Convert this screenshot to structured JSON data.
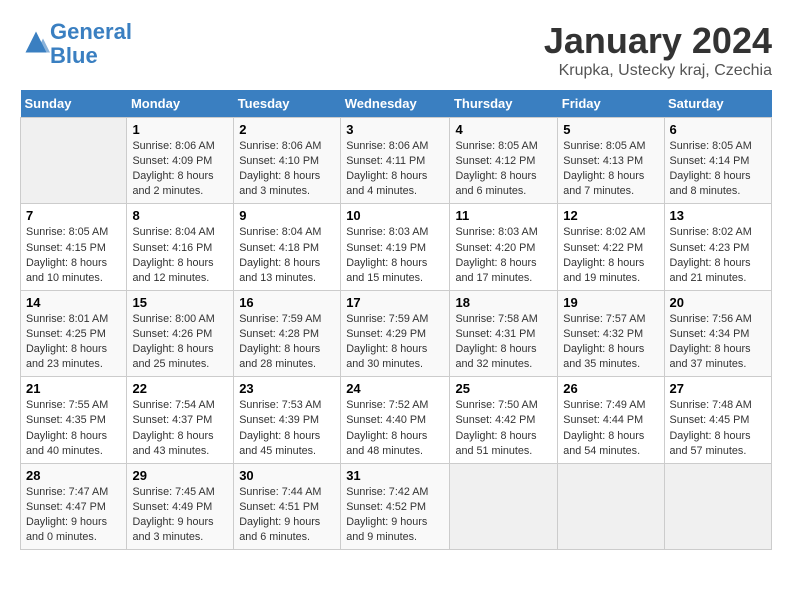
{
  "logo": {
    "line1": "General",
    "line2": "Blue"
  },
  "title": "January 2024",
  "subtitle": "Krupka, Ustecky kraj, Czechia",
  "days_of_week": [
    "Sunday",
    "Monday",
    "Tuesday",
    "Wednesday",
    "Thursday",
    "Friday",
    "Saturday"
  ],
  "weeks": [
    [
      {
        "num": "",
        "info": ""
      },
      {
        "num": "1",
        "info": "Sunrise: 8:06 AM\nSunset: 4:09 PM\nDaylight: 8 hours\nand 2 minutes."
      },
      {
        "num": "2",
        "info": "Sunrise: 8:06 AM\nSunset: 4:10 PM\nDaylight: 8 hours\nand 3 minutes."
      },
      {
        "num": "3",
        "info": "Sunrise: 8:06 AM\nSunset: 4:11 PM\nDaylight: 8 hours\nand 4 minutes."
      },
      {
        "num": "4",
        "info": "Sunrise: 8:05 AM\nSunset: 4:12 PM\nDaylight: 8 hours\nand 6 minutes."
      },
      {
        "num": "5",
        "info": "Sunrise: 8:05 AM\nSunset: 4:13 PM\nDaylight: 8 hours\nand 7 minutes."
      },
      {
        "num": "6",
        "info": "Sunrise: 8:05 AM\nSunset: 4:14 PM\nDaylight: 8 hours\nand 8 minutes."
      }
    ],
    [
      {
        "num": "7",
        "info": "Sunrise: 8:05 AM\nSunset: 4:15 PM\nDaylight: 8 hours\nand 10 minutes."
      },
      {
        "num": "8",
        "info": "Sunrise: 8:04 AM\nSunset: 4:16 PM\nDaylight: 8 hours\nand 12 minutes."
      },
      {
        "num": "9",
        "info": "Sunrise: 8:04 AM\nSunset: 4:18 PM\nDaylight: 8 hours\nand 13 minutes."
      },
      {
        "num": "10",
        "info": "Sunrise: 8:03 AM\nSunset: 4:19 PM\nDaylight: 8 hours\nand 15 minutes."
      },
      {
        "num": "11",
        "info": "Sunrise: 8:03 AM\nSunset: 4:20 PM\nDaylight: 8 hours\nand 17 minutes."
      },
      {
        "num": "12",
        "info": "Sunrise: 8:02 AM\nSunset: 4:22 PM\nDaylight: 8 hours\nand 19 minutes."
      },
      {
        "num": "13",
        "info": "Sunrise: 8:02 AM\nSunset: 4:23 PM\nDaylight: 8 hours\nand 21 minutes."
      }
    ],
    [
      {
        "num": "14",
        "info": "Sunrise: 8:01 AM\nSunset: 4:25 PM\nDaylight: 8 hours\nand 23 minutes."
      },
      {
        "num": "15",
        "info": "Sunrise: 8:00 AM\nSunset: 4:26 PM\nDaylight: 8 hours\nand 25 minutes."
      },
      {
        "num": "16",
        "info": "Sunrise: 7:59 AM\nSunset: 4:28 PM\nDaylight: 8 hours\nand 28 minutes."
      },
      {
        "num": "17",
        "info": "Sunrise: 7:59 AM\nSunset: 4:29 PM\nDaylight: 8 hours\nand 30 minutes."
      },
      {
        "num": "18",
        "info": "Sunrise: 7:58 AM\nSunset: 4:31 PM\nDaylight: 8 hours\nand 32 minutes."
      },
      {
        "num": "19",
        "info": "Sunrise: 7:57 AM\nSunset: 4:32 PM\nDaylight: 8 hours\nand 35 minutes."
      },
      {
        "num": "20",
        "info": "Sunrise: 7:56 AM\nSunset: 4:34 PM\nDaylight: 8 hours\nand 37 minutes."
      }
    ],
    [
      {
        "num": "21",
        "info": "Sunrise: 7:55 AM\nSunset: 4:35 PM\nDaylight: 8 hours\nand 40 minutes."
      },
      {
        "num": "22",
        "info": "Sunrise: 7:54 AM\nSunset: 4:37 PM\nDaylight: 8 hours\nand 43 minutes."
      },
      {
        "num": "23",
        "info": "Sunrise: 7:53 AM\nSunset: 4:39 PM\nDaylight: 8 hours\nand 45 minutes."
      },
      {
        "num": "24",
        "info": "Sunrise: 7:52 AM\nSunset: 4:40 PM\nDaylight: 8 hours\nand 48 minutes."
      },
      {
        "num": "25",
        "info": "Sunrise: 7:50 AM\nSunset: 4:42 PM\nDaylight: 8 hours\nand 51 minutes."
      },
      {
        "num": "26",
        "info": "Sunrise: 7:49 AM\nSunset: 4:44 PM\nDaylight: 8 hours\nand 54 minutes."
      },
      {
        "num": "27",
        "info": "Sunrise: 7:48 AM\nSunset: 4:45 PM\nDaylight: 8 hours\nand 57 minutes."
      }
    ],
    [
      {
        "num": "28",
        "info": "Sunrise: 7:47 AM\nSunset: 4:47 PM\nDaylight: 9 hours\nand 0 minutes."
      },
      {
        "num": "29",
        "info": "Sunrise: 7:45 AM\nSunset: 4:49 PM\nDaylight: 9 hours\nand 3 minutes."
      },
      {
        "num": "30",
        "info": "Sunrise: 7:44 AM\nSunset: 4:51 PM\nDaylight: 9 hours\nand 6 minutes."
      },
      {
        "num": "31",
        "info": "Sunrise: 7:42 AM\nSunset: 4:52 PM\nDaylight: 9 hours\nand 9 minutes."
      },
      {
        "num": "",
        "info": ""
      },
      {
        "num": "",
        "info": ""
      },
      {
        "num": "",
        "info": ""
      }
    ]
  ]
}
